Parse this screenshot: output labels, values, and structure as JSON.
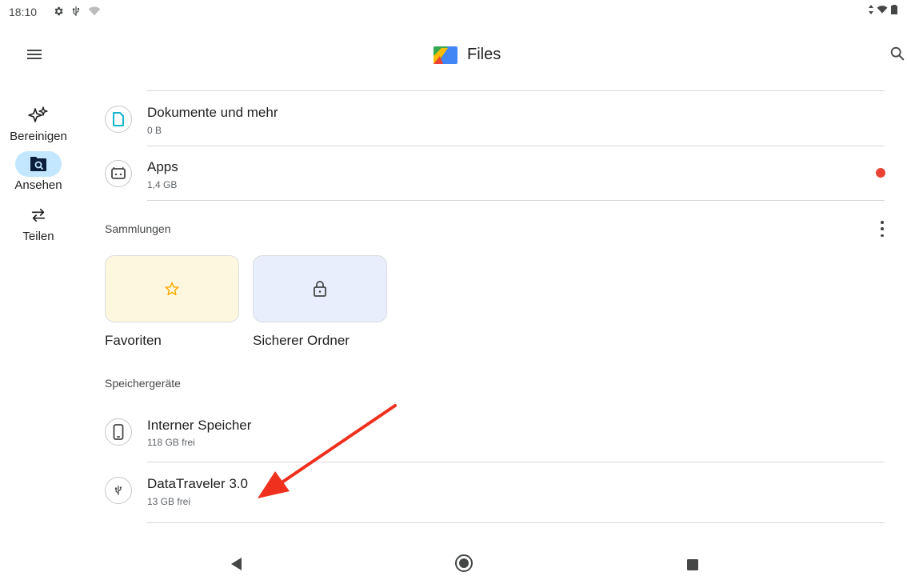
{
  "status_bar": {
    "time": "18:10",
    "icons": [
      "gear-icon",
      "usb-icon",
      "wifi-icon"
    ],
    "right_icons": [
      "data-icon",
      "wifi-icon",
      "battery-icon"
    ]
  },
  "top_bar": {
    "title": "Files",
    "menu_icon": "menu-icon",
    "search_icon": "search-icon"
  },
  "nav_rail": {
    "items": [
      {
        "label": "Bereinigen",
        "icon": "sparkle-icon",
        "active": false
      },
      {
        "label": "Ansehen",
        "icon": "folder-search-icon",
        "active": true
      },
      {
        "label": "Teilen",
        "icon": "swap-icon",
        "active": false
      }
    ]
  },
  "categories": [
    {
      "title": "Dokumente und mehr",
      "subtitle": "0 B",
      "icon": "document-icon",
      "icon_color": "#12b5cb"
    },
    {
      "title": "Apps",
      "subtitle": "1,4 GB",
      "icon": "android-icon",
      "icon_color": "#444746",
      "badge_color": "#ea4335"
    }
  ],
  "collections": {
    "label": "Sammlungen",
    "items": [
      {
        "label": "Favoriten",
        "icon": "star-icon",
        "bg": "#fef7e0",
        "icon_color": "#f9ab00"
      },
      {
        "label": "Sicherer Ordner",
        "icon": "lock-icon",
        "bg": "#e8eefb",
        "icon_color": "#444746"
      }
    ]
  },
  "storage": {
    "label": "Speichergeräte",
    "devices": [
      {
        "title": "Interner Speicher",
        "subtitle": "118 GB frei",
        "icon": "phone-icon"
      },
      {
        "title": "DataTraveler 3.0",
        "subtitle": "13 GB frei",
        "icon": "usb-icon"
      }
    ]
  },
  "nav_bar": {
    "buttons": [
      "back-icon",
      "home-icon",
      "recents-icon"
    ]
  },
  "annotation": {
    "color": "#f0301e"
  }
}
